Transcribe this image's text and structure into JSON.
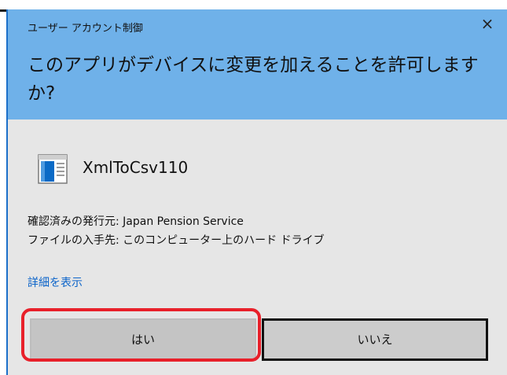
{
  "dialog": {
    "window_title": "ユーザー アカウント制御",
    "question": "このアプリがデバイスに変更を加えることを許可しますか?",
    "app_name": "XmlToCsv110",
    "publisher_line": "確認済みの発行元: Japan Pension Service",
    "origin_line": "ファイルの入手先: このコンピューター上のハード ドライブ",
    "details_link": "詳細を表示",
    "yes_button": "はい",
    "no_button": "いいえ"
  },
  "icons": {
    "close": "close-icon",
    "app": "application-window-icon"
  },
  "colors": {
    "header_bg": "#6fb1e9",
    "body_bg": "#e6e6e6",
    "link": "#0a63c9",
    "highlight": "#e8202a"
  }
}
